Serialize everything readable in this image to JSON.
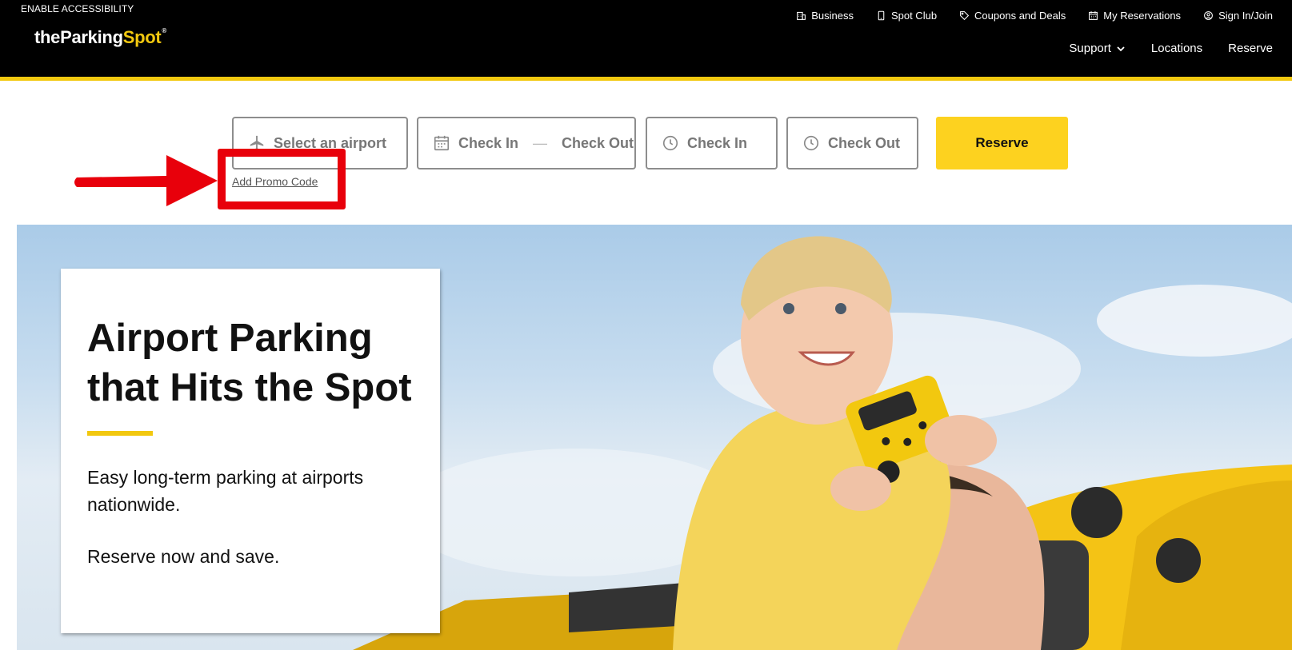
{
  "header": {
    "accessibility_link": "ENABLE ACCESSIBILITY",
    "logo": {
      "the": "the",
      "parking": "Parking",
      "spot": "Spot",
      "mark": "®"
    },
    "utility_nav": [
      "Business",
      "Spot Club",
      "Coupons and Deals",
      "My Reservations",
      "Sign In/Join"
    ],
    "main_nav": {
      "support": "Support",
      "locations": "Locations",
      "reserve": "Reserve"
    }
  },
  "booking": {
    "airport_placeholder": "Select an airport",
    "date_range": {
      "check_in": "Check In",
      "check_out": "Check Out"
    },
    "check_in_time": "Check In",
    "check_out_time": "Check Out",
    "reserve_button": "Reserve",
    "promo_link": "Add Promo Code"
  },
  "hero": {
    "headline_line1": "Airport Parking",
    "headline_line2": "that Hits the Spot",
    "description": "Easy long-term parking at airports nationwide.",
    "cta_text": "Reserve now and save."
  },
  "colors": {
    "brand_yellow": "#f2c80f",
    "button_yellow": "#fdd21f",
    "header_bg": "#000000",
    "annotation_red": "#e8000b"
  },
  "icons": [
    "building-icon",
    "phone-icon",
    "tag-icon",
    "calendar-icon",
    "user-icon",
    "chevron-down-icon",
    "airplane-icon",
    "clock-icon"
  ]
}
